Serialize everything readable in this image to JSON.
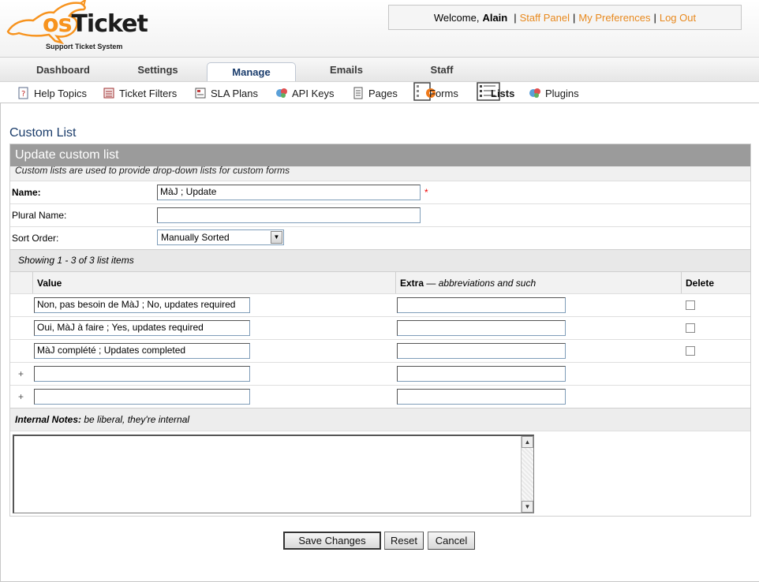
{
  "header": {
    "logo_os": "os",
    "logo_ticket": "Ticket",
    "logo_subtitle": "Support Ticket System",
    "welcome_prefix": "Welcome,",
    "user_name": "Alain",
    "links": [
      "Staff Panel",
      "My Preferences",
      "Log Out"
    ]
  },
  "nav": {
    "tabs": [
      {
        "label": "Dashboard"
      },
      {
        "label": "Settings"
      },
      {
        "label": "Manage",
        "active": true
      },
      {
        "label": "Emails"
      },
      {
        "label": "Staff"
      }
    ]
  },
  "subnav": {
    "items": [
      {
        "label": "Help Topics",
        "icon": "help-topics-icon"
      },
      {
        "label": "Ticket Filters",
        "icon": "ticket-filters-icon"
      },
      {
        "label": "SLA Plans",
        "icon": "sla-plans-icon"
      },
      {
        "label": "API Keys",
        "icon": "api-keys-icon"
      },
      {
        "label": "Pages",
        "icon": "pages-icon"
      },
      {
        "label": "Forms",
        "icon": "forms-icon"
      },
      {
        "label": "Lists",
        "icon": "lists-icon",
        "active": true
      },
      {
        "label": "Plugins",
        "icon": "plugins-icon"
      }
    ]
  },
  "page_title": "Custom List",
  "form": {
    "heading": "Update custom list",
    "description": "Custom lists are used to provide drop-down lists for custom forms",
    "name_label": "Name:",
    "name_value": "MàJ ; Update",
    "required_mark": "*",
    "plural_label": "Plural Name:",
    "plural_value": "",
    "sort_label": "Sort Order:",
    "sort_value": "Manually Sorted"
  },
  "list_items": {
    "showing": "Showing  1 - 3 of 3 list items",
    "col_value": "Value",
    "col_extra": "Extra",
    "col_extra_note": "abbreviations and such",
    "col_extra_dash": "—",
    "col_delete": "Delete",
    "rows": [
      {
        "value": "Non, pas besoin de MàJ ; No, updates required",
        "extra": ""
      },
      {
        "value": "Oui, MàJ à faire ; Yes, updates required",
        "extra": ""
      },
      {
        "value": "MàJ complété ; Updates completed",
        "extra": ""
      }
    ],
    "new_rows": [
      {
        "marker": "+",
        "value": "",
        "extra": ""
      },
      {
        "marker": "+",
        "value": "",
        "extra": ""
      }
    ]
  },
  "notes": {
    "label": "Internal Notes:",
    "hint": "be liberal, they're internal",
    "value": ""
  },
  "buttons": {
    "save": "Save Changes",
    "reset": "Reset",
    "cancel": "Cancel"
  },
  "colors": {
    "accent_orange": "#e8891e",
    "title_blue": "#1b3d6b",
    "header_bar": "#9b9b9b"
  }
}
